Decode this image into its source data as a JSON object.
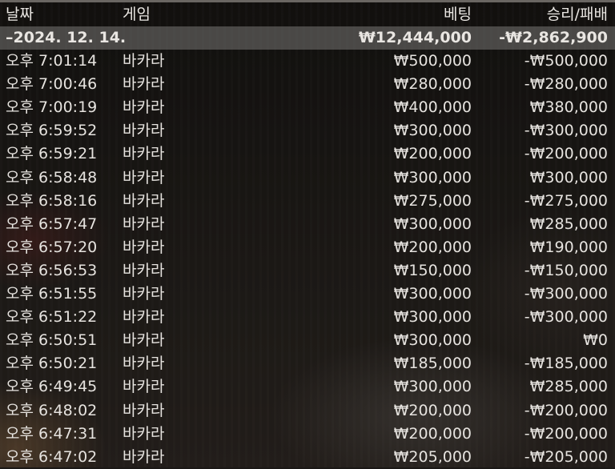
{
  "columns": {
    "date": "날짜",
    "game": "게임",
    "bet": "베팅",
    "win_loss": "승리/패배"
  },
  "summary": {
    "date": "–2024. 12. 14.",
    "bet": "₩12,444,000",
    "win_loss": "-₩2,862,900"
  },
  "rows": [
    {
      "time": "오후 7:01:14",
      "game": "바카라",
      "bet": "₩500,000",
      "win_loss": "-₩500,000"
    },
    {
      "time": "오후 7:00:46",
      "game": "바카라",
      "bet": "₩280,000",
      "win_loss": "-₩280,000"
    },
    {
      "time": "오후 7:00:19",
      "game": "바카라",
      "bet": "₩400,000",
      "win_loss": "₩380,000"
    },
    {
      "time": "오후 6:59:52",
      "game": "바카라",
      "bet": "₩300,000",
      "win_loss": "-₩300,000"
    },
    {
      "time": "오후 6:59:21",
      "game": "바카라",
      "bet": "₩200,000",
      "win_loss": "-₩200,000"
    },
    {
      "time": "오후 6:58:48",
      "game": "바카라",
      "bet": "₩300,000",
      "win_loss": "₩300,000"
    },
    {
      "time": "오후 6:58:16",
      "game": "바카라",
      "bet": "₩275,000",
      "win_loss": "-₩275,000"
    },
    {
      "time": "오후 6:57:47",
      "game": "바카라",
      "bet": "₩300,000",
      "win_loss": "₩285,000"
    },
    {
      "time": "오후 6:57:20",
      "game": "바카라",
      "bet": "₩200,000",
      "win_loss": "₩190,000"
    },
    {
      "time": "오후 6:56:53",
      "game": "바카라",
      "bet": "₩150,000",
      "win_loss": "-₩150,000"
    },
    {
      "time": "오후 6:51:55",
      "game": "바카라",
      "bet": "₩300,000",
      "win_loss": "-₩300,000"
    },
    {
      "time": "오후 6:51:22",
      "game": "바카라",
      "bet": "₩300,000",
      "win_loss": "-₩300,000"
    },
    {
      "time": "오후 6:50:51",
      "game": "바카라",
      "bet": "₩300,000",
      "win_loss": "₩0"
    },
    {
      "time": "오후 6:50:21",
      "game": "바카라",
      "bet": "₩185,000",
      "win_loss": "-₩185,000"
    },
    {
      "time": "오후 6:49:45",
      "game": "바카라",
      "bet": "₩300,000",
      "win_loss": "₩285,000"
    },
    {
      "time": "오후 6:48:02",
      "game": "바카라",
      "bet": "₩200,000",
      "win_loss": "-₩200,000"
    },
    {
      "time": "오후 6:47:31",
      "game": "바카라",
      "bet": "₩200,000",
      "win_loss": "-₩200,000"
    },
    {
      "time": "오후 6:47:02",
      "game": "바카라",
      "bet": "₩205,000",
      "win_loss": "-₩205,000"
    }
  ]
}
